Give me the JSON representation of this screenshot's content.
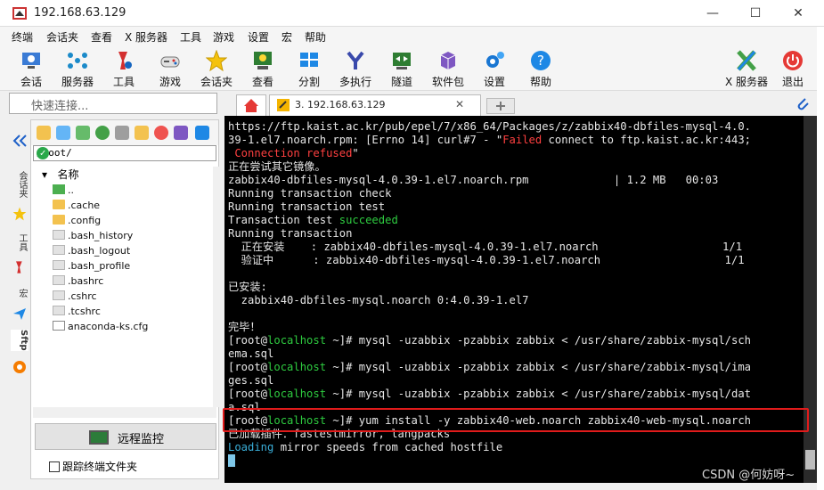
{
  "window": {
    "title": "192.168.63.129",
    "minimize": "—",
    "maximize": "☐",
    "close": "✕"
  },
  "menu": [
    "终端",
    "会话夹",
    "查看",
    "X 服务器",
    "工具",
    "游戏",
    "设置",
    "宏",
    "帮助"
  ],
  "toolbar": [
    {
      "label": "会话",
      "icon": "session-icon"
    },
    {
      "label": "服务器",
      "icon": "servers-icon"
    },
    {
      "label": "工具",
      "icon": "tools-icon"
    },
    {
      "label": "游戏",
      "icon": "games-icon"
    },
    {
      "label": "会话夹",
      "icon": "star-icon"
    },
    {
      "label": "查看",
      "icon": "view-icon"
    },
    {
      "label": "分割",
      "icon": "split-icon"
    },
    {
      "label": "多执行",
      "icon": "multiexec-icon"
    },
    {
      "label": "隧道",
      "icon": "tunnel-icon"
    },
    {
      "label": "软件包",
      "icon": "packages-icon"
    },
    {
      "label": "设置",
      "icon": "settings-icon"
    },
    {
      "label": "帮助",
      "icon": "help-icon"
    },
    {
      "label": "X 服务器",
      "icon": "xserver-icon"
    },
    {
      "label": "退出",
      "icon": "power-icon"
    }
  ],
  "quick_connect": {
    "placeholder": "快速连接..."
  },
  "tabs": {
    "active": "3. 192.168.63.129"
  },
  "sidebar": [
    "会话夹",
    "工具",
    "宏",
    "Sftp"
  ],
  "sftp": {
    "path": "/root/",
    "column": "名称",
    "files": [
      {
        "name": "..",
        "type": "up"
      },
      {
        "name": ".cache",
        "type": "folder"
      },
      {
        "name": ".config",
        "type": "folder"
      },
      {
        "name": ".bash_history",
        "type": "file"
      },
      {
        "name": ".bash_logout",
        "type": "file"
      },
      {
        "name": ".bash_profile",
        "type": "file"
      },
      {
        "name": ".bashrc",
        "type": "file"
      },
      {
        "name": ".cshrc",
        "type": "file"
      },
      {
        "name": ".tcshrc",
        "type": "file"
      },
      {
        "name": "anaconda-ks.cfg",
        "type": "cfg"
      }
    ],
    "monitor_label": "远程监控",
    "follow_label": "跟踪终端文件夹"
  },
  "terminal": {
    "lines": [
      [
        {
          "t": "https://ftp.kaist.ac.kr/pub/epel/7/x86_64/Packages/z/zabbix40-dbfiles-mysql-4.0."
        }
      ],
      [
        {
          "t": "39-1.el7.noarch.rpm: [Errno 14] curl#7 - \""
        },
        {
          "t": "Failed",
          "c": "r"
        },
        {
          "t": " connect to ftp.kaist.ac.kr:443;"
        }
      ],
      [
        {
          "t": " "
        },
        {
          "t": "Connection refused",
          "c": "r"
        },
        {
          "t": "\""
        }
      ],
      [
        {
          "t": "正在尝试其它镜像。"
        }
      ],
      [
        {
          "t": "zabbix40-dbfiles-mysql-4.0.39-1.el7.noarch.rpm             | 1.2 MB   00:03"
        }
      ],
      [
        {
          "t": "Running transaction check"
        }
      ],
      [
        {
          "t": "Running transaction test"
        }
      ],
      [
        {
          "t": "Transaction test "
        },
        {
          "t": "succeeded",
          "c": "g"
        }
      ],
      [
        {
          "t": "Running transaction"
        }
      ],
      [
        {
          "t": "  正在安装    : zabbix40-dbfiles-mysql-4.0.39-1.el7.noarch                   1/1"
        }
      ],
      [
        {
          "t": "  验证中      : zabbix40-dbfiles-mysql-4.0.39-1.el7.noarch                   1/1"
        }
      ],
      [
        {
          "t": ""
        }
      ],
      [
        {
          "t": "已安装:"
        }
      ],
      [
        {
          "t": "  zabbix40-dbfiles-mysql.noarch 0:4.0.39-1.el7"
        }
      ],
      [
        {
          "t": ""
        }
      ],
      [
        {
          "t": "完毕！"
        }
      ],
      [
        {
          "t": "[root@"
        },
        {
          "t": "localhost",
          "c": "g"
        },
        {
          "t": " ~]# mysql -uzabbix -pzabbix zabbix < /usr/share/zabbix-mysql/sch"
        }
      ],
      [
        {
          "t": "ema.sql"
        }
      ],
      [
        {
          "t": "[root@"
        },
        {
          "t": "localhost",
          "c": "g"
        },
        {
          "t": " ~]# mysql -uzabbix -pzabbix zabbix < /usr/share/zabbix-mysql/ima"
        }
      ],
      [
        {
          "t": "ges.sql"
        }
      ],
      [
        {
          "t": "[root@"
        },
        {
          "t": "localhost",
          "c": "g"
        },
        {
          "t": " ~]# mysql -uzabbix -pzabbix zabbix < /usr/share/zabbix-mysql/dat"
        }
      ],
      [
        {
          "t": "a.sql"
        }
      ],
      [
        {
          "t": "[root@"
        },
        {
          "t": "localhost",
          "c": "g"
        },
        {
          "t": " ~]# yum install -y zabbix40-web.noarch zabbix40-web-mysql.noarch"
        }
      ],
      [
        {
          "t": "已加载插件：fastestmirror, langpacks"
        }
      ],
      [
        {
          "t": "Loading",
          "c": "c"
        },
        {
          "t": " mirror speeds from cached hostfile"
        }
      ]
    ]
  },
  "watermark": "CSDN @何妨呀~",
  "colors": {
    "highlight_box": "#e01b1b",
    "prompt_host": "#2ecc40",
    "error": "#ff4040",
    "loading": "#3aaed8"
  }
}
